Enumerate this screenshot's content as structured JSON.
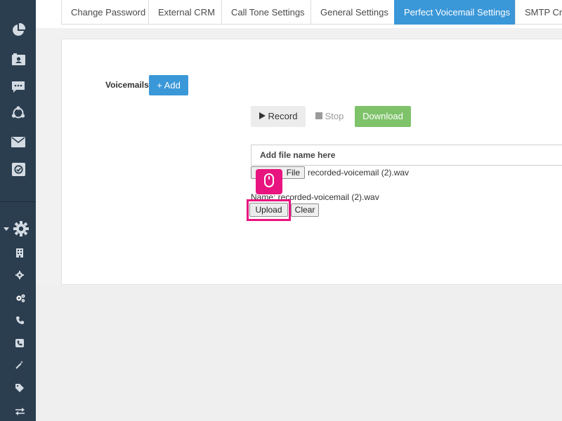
{
  "tabs": [
    {
      "label": "Change Password"
    },
    {
      "label": "External CRM"
    },
    {
      "label": "Call Tone Settings"
    },
    {
      "label": "General Settings"
    },
    {
      "label": "Perfect Voicemail Settings",
      "active": true
    },
    {
      "label": "SMTP Cre"
    }
  ],
  "voicemails": {
    "label": "Voicemails",
    "add_label": "+ Add"
  },
  "recorder": {
    "record_label": "Record",
    "stop_label": "Stop",
    "download_label": "Download"
  },
  "file": {
    "name_placeholder": "Add file name here",
    "choose_label": "File",
    "chosen_file": "recorded-voicemail (2).wav",
    "name_line": "Name: recorded-voicemail (2).wav",
    "upload_label": "Upload",
    "clear_label": "Clear"
  },
  "colors": {
    "sidebar": "#2b3e50",
    "accent": "#3a97d8",
    "download": "#7ec26a",
    "highlight": "#e8147f"
  },
  "sidebar_icons": [
    "pie-chart-icon",
    "contact-card-icon",
    "chat-icon",
    "network-icon",
    "envelope-icon",
    "check-badge-icon",
    "settings-gear-icon",
    "building-icon",
    "small-gear-icon",
    "gears-icon",
    "phone-icon",
    "phone-square-icon",
    "magic-wand-icon",
    "tag-icon",
    "exchange-icon"
  ]
}
